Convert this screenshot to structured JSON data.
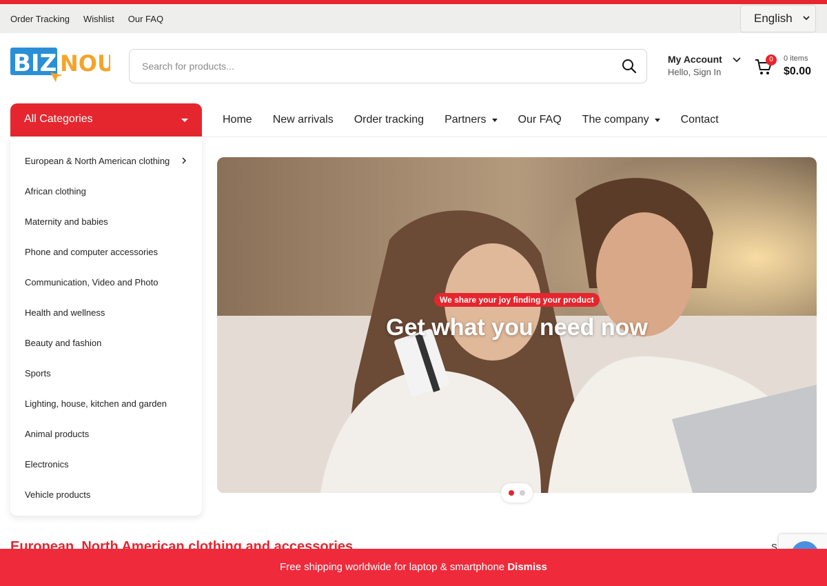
{
  "topbar": {
    "links": [
      "Order Tracking",
      "Wishlist",
      "Our FAQ"
    ],
    "language": "English"
  },
  "brand": {
    "logo_left": "BIZ",
    "logo_right": "NOU",
    "colors": {
      "blue": "#2a8fd6",
      "orange": "#f3a52b",
      "red": "#e5262e"
    }
  },
  "search": {
    "placeholder": "Search for products..."
  },
  "account": {
    "title": "My Account",
    "subtitle": "Hello, Sign In"
  },
  "cart": {
    "count": "0",
    "items_label": "0 items",
    "total": "$0.00"
  },
  "categories": {
    "header": "All Categories",
    "items": [
      "European & North American clothing",
      "African clothing",
      "Maternity and babies",
      "Phone and computer accessories",
      "Communication, Video and Photo",
      "Health and wellness",
      "Beauty and fashion",
      "Sports",
      "Lighting, house, kitchen and garden",
      "Animal products",
      "Electronics",
      "Vehicle products"
    ]
  },
  "nav": {
    "items": [
      "Home",
      "New arrivals",
      "Order tracking",
      "Partners",
      "Our FAQ",
      "The company",
      "Contact"
    ]
  },
  "hero": {
    "tagline": "We share your joy finding your product",
    "title": "Get what you need now",
    "slides": 2,
    "active_slide": 1
  },
  "section": {
    "title": "European, North American clothing and accessories",
    "right_text": "S"
  },
  "notice": {
    "text": "Free shipping worldwide for laptop & smartphone",
    "dismiss": "Dismiss"
  }
}
